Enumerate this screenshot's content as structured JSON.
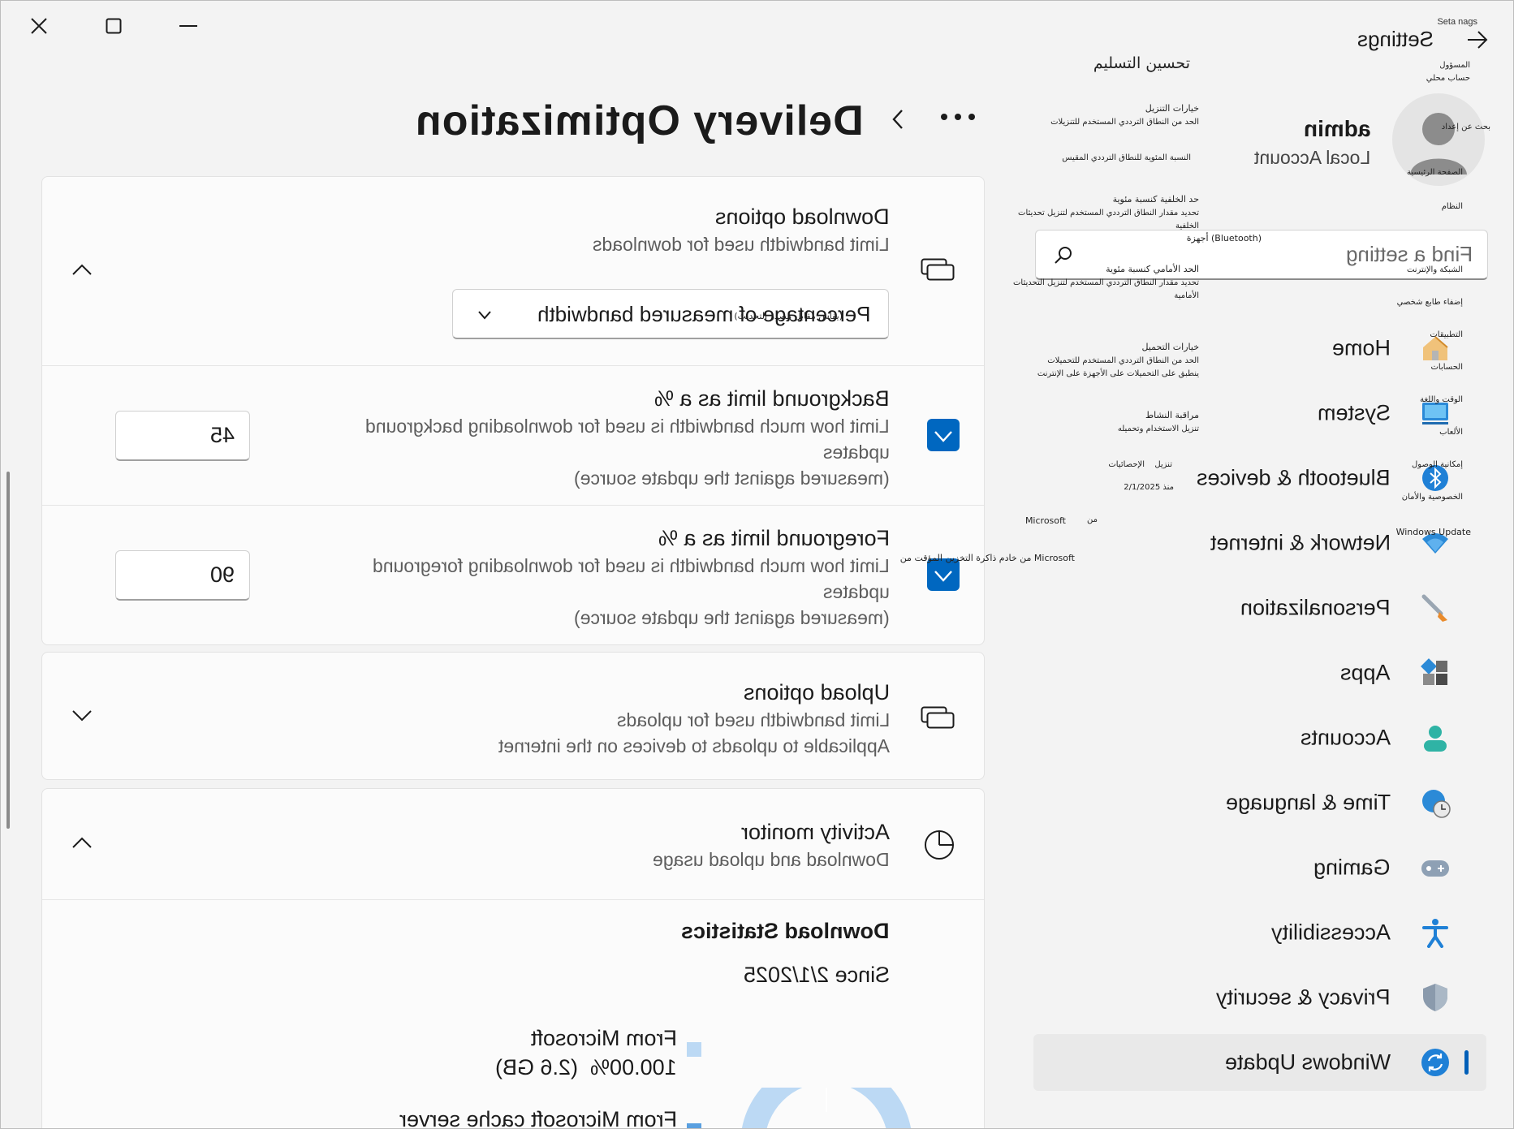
{
  "window": {
    "app_title": "Settings",
    "app_subtitle": "Seta nags"
  },
  "user": {
    "name": "admin",
    "account_type": "Local Account"
  },
  "search": {
    "placeholder": "Find a setting"
  },
  "sidebar": {
    "items": [
      {
        "label": "Home",
        "icon": "home-icon"
      },
      {
        "label": "System",
        "icon": "system-icon"
      },
      {
        "label": "Bluetooth & devices",
        "icon": "bluetooth-icon"
      },
      {
        "label": "Network & internet",
        "icon": "network-icon"
      },
      {
        "label": "Personalization",
        "icon": "brush-icon"
      },
      {
        "label": "Apps",
        "icon": "apps-icon"
      },
      {
        "label": "Accounts",
        "icon": "person-icon"
      },
      {
        "label": "Time & language",
        "icon": "globe-clock-icon"
      },
      {
        "label": "Gaming",
        "icon": "gamepad-icon"
      },
      {
        "label": "Accessibility",
        "icon": "accessibility-icon"
      },
      {
        "label": "Privacy & security",
        "icon": "shield-icon"
      },
      {
        "label": "Windows Update",
        "icon": "sync-icon",
        "active": true
      }
    ]
  },
  "header": {
    "title": "Delivery Optimization"
  },
  "download_options": {
    "title": "Download options",
    "subtitle": "Limit bandwidth used for downloads",
    "dropdown_value": "Percentage of measured bandwidth",
    "background": {
      "title": "Background limit as a %",
      "line1": "Limit how much bandwidth is used for downloading background",
      "line2": "updates",
      "line3": "(measured against the update source)",
      "value": "45"
    },
    "foreground": {
      "title": "Foreground limit as a %",
      "line1": "Limit how much bandwidth is used for downloading foreground",
      "line2": "updates",
      "line3": "(measured against the update source)",
      "value": "90"
    }
  },
  "upload_options": {
    "title": "Upload options",
    "subtitle": "Limit bandwidth used for uploads",
    "subtitle2": "Applicable to uploads to devices on the internet"
  },
  "activity_monitor": {
    "title": "Activity monitor",
    "subtitle": "Download and upload usage",
    "stats_title": "Download Statistics",
    "since": "Since 2/1/2025",
    "legend": [
      {
        "label": "From Microsoft",
        "value": "100.00%  (2.6 GB)",
        "color": "#bcd9f4"
      },
      {
        "label": "From Microsoft cache server",
        "color": "#5aa0e0"
      }
    ]
  },
  "overlay_ar": {
    "title": "تحسين التسليم",
    "nav_system_label": "الصفحة الرئيسية",
    "acc": "حساب محلي",
    "nav_user": "المسؤول",
    "search": "بحث عن إعداد",
    "system": "النظام",
    "bt": "أجهزة (Bluetooth)",
    "net": "الشبكة والإنترنت",
    "pers": "إضفاء طابع شخصي",
    "apps": "التطبيقات",
    "accounts": "الحسابات",
    "time": "الوقت واللغة",
    "gaming": "الألعاب",
    "accessibility": "إمكانية الوصول",
    "privacy": "الخصوصية والأمان",
    "wu": "Windows Update",
    "dl_title": "خيارات التنزيل",
    "dl_sub": "الحد من النطاق الترددي المستخدم للتنزيلات",
    "dl_pct": "النسبة المئوية للنطاق الترددي المقيس",
    "bg_title": "حد الخلفية كنسبة مئوية",
    "bg_l1": "تحديد مقدار النطاق الترددي المستخدم لتنزيل تحديثات",
    "bg_l2": "الخلفية",
    "bg_l3": "(يقاس مقابل مصدر التحديث)",
    "fg_title": "الحد الأمامي كنسبة مئوية",
    "fg_l1": "تحديد مقدار النطاق الترددي المستخدم لتنزيل التحديثات",
    "fg_l2": "الأمامية",
    "dd": "(يقاس مقابل مصدر التحديث)",
    "ul_title": "خيارات التحميل",
    "ul_sub": "الحد من النطاق الترددي المستخدم للتحميلات",
    "ul_sub2": "ينطبق على التحميلات على الأجهزة على الإنترنت",
    "am_title": "مراقبة النشاط",
    "am_sub": "تنزيل الاستخدام وتحميله",
    "stats": "تنزيل",
    "stats2": "الإحصائيات",
    "since": "منذ 2/1/2025",
    "from": "من",
    "ms": "Microsoft",
    "cache": "من خادم ذاكرة التخزين المؤقت من Microsoft"
  }
}
